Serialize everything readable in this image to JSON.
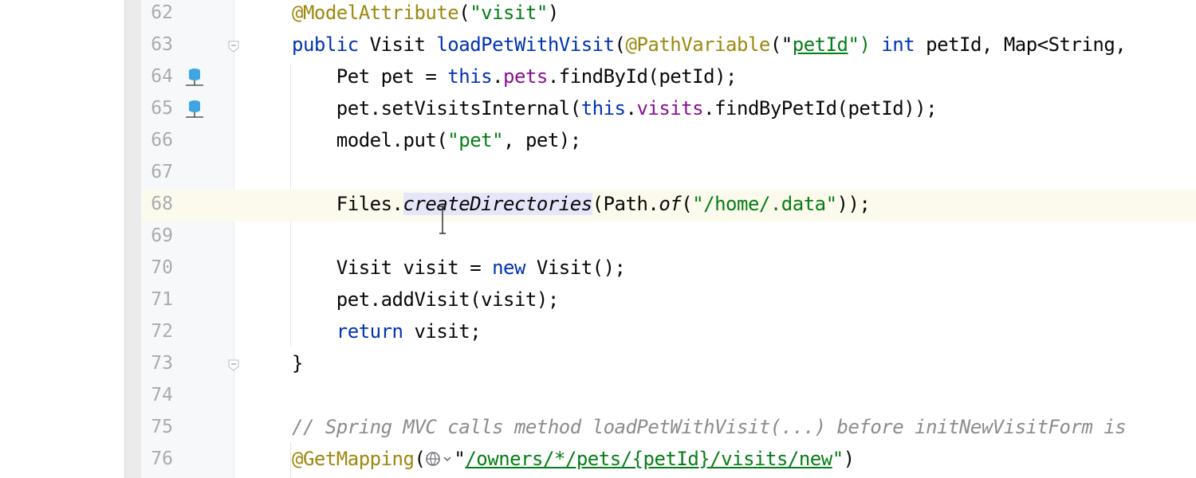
{
  "editor": {
    "lines": [
      {
        "num": "62",
        "tokens": [
          {
            "t": "@ModelAttribute",
            "c": "ann"
          },
          {
            "t": "("
          },
          {
            "t": "\"visit\"",
            "c": "str"
          },
          {
            "t": ")"
          }
        ]
      },
      {
        "num": "63",
        "tokens": [
          {
            "t": "public",
            "c": "kw"
          },
          {
            "t": " Visit "
          },
          {
            "t": "loadPetWithVisit",
            "c": "kw"
          },
          {
            "t": "("
          },
          {
            "t": "@PathVariable",
            "c": "ann"
          },
          {
            "t": "(\""
          },
          {
            "t": "petId",
            "c": "str ul"
          },
          {
            "t": "\")",
            "c": "str"
          },
          {
            "t": " "
          },
          {
            "t": "int",
            "c": "kw"
          },
          {
            "t": " petId, Map<String,"
          }
        ]
      },
      {
        "num": "64",
        "tokens": [
          {
            "t": "    Pet pet = "
          },
          {
            "t": "this",
            "c": "kw"
          },
          {
            "t": "."
          },
          {
            "t": "pets",
            "c": "fld"
          },
          {
            "t": ".findById(petId);"
          }
        ]
      },
      {
        "num": "65",
        "tokens": [
          {
            "t": "    pet.setVisitsInternal("
          },
          {
            "t": "this",
            "c": "kw"
          },
          {
            "t": "."
          },
          {
            "t": "visits",
            "c": "fld"
          },
          {
            "t": ".findByPetId(petId));"
          }
        ]
      },
      {
        "num": "66",
        "tokens": [
          {
            "t": "    model.put("
          },
          {
            "t": "\"pet\"",
            "c": "str"
          },
          {
            "t": ", pet);"
          }
        ]
      },
      {
        "num": "67",
        "tokens": []
      },
      {
        "num": "68",
        "tokens": [
          {
            "t": "    Files."
          },
          {
            "t": "createDirectories",
            "c": "ital hl"
          },
          {
            "t": "(Path."
          },
          {
            "t": "of",
            "c": "ital"
          },
          {
            "t": "("
          },
          {
            "t": "\"/home/.data\"",
            "c": "str"
          },
          {
            "t": "));"
          }
        ]
      },
      {
        "num": "69",
        "tokens": []
      },
      {
        "num": "70",
        "tokens": [
          {
            "t": "    Visit visit = "
          },
          {
            "t": "new",
            "c": "kw"
          },
          {
            "t": " Visit();"
          }
        ]
      },
      {
        "num": "71",
        "tokens": [
          {
            "t": "    pet.addVisit(visit);"
          }
        ]
      },
      {
        "num": "72",
        "tokens": [
          {
            "t": "    "
          },
          {
            "t": "return",
            "c": "kw"
          },
          {
            "t": " visit;"
          }
        ]
      },
      {
        "num": "73",
        "tokens": [
          {
            "t": "}"
          }
        ]
      },
      {
        "num": "74",
        "tokens": []
      },
      {
        "num": "75",
        "tokens": [
          {
            "t": "// Spring MVC calls method loadPetWithVisit(...) before initNewVisitForm is",
            "c": "cmt"
          }
        ]
      },
      {
        "num": "76",
        "tokens": [
          {
            "t": "@GetMapping",
            "c": "ann"
          },
          {
            "t": "("
          },
          {
            "t": "GLOBE"
          },
          {
            "t": "\""
          },
          {
            "t": "/owners/*/pets/{petId}/visits/new",
            "c": "str ul"
          },
          {
            "t": "\"",
            "c": "str"
          },
          {
            "t": ")"
          }
        ]
      }
    ],
    "current_line": "68",
    "db_icon_lines": [
      "64",
      "65"
    ],
    "fold_lines": [
      "63",
      "73"
    ],
    "colors": {
      "keyword": "#0033b3",
      "annotation": "#9e880d",
      "string": "#067d17",
      "field": "#871094",
      "comment": "#8c8c8c",
      "current_line_bg": "#fcfaed"
    }
  }
}
